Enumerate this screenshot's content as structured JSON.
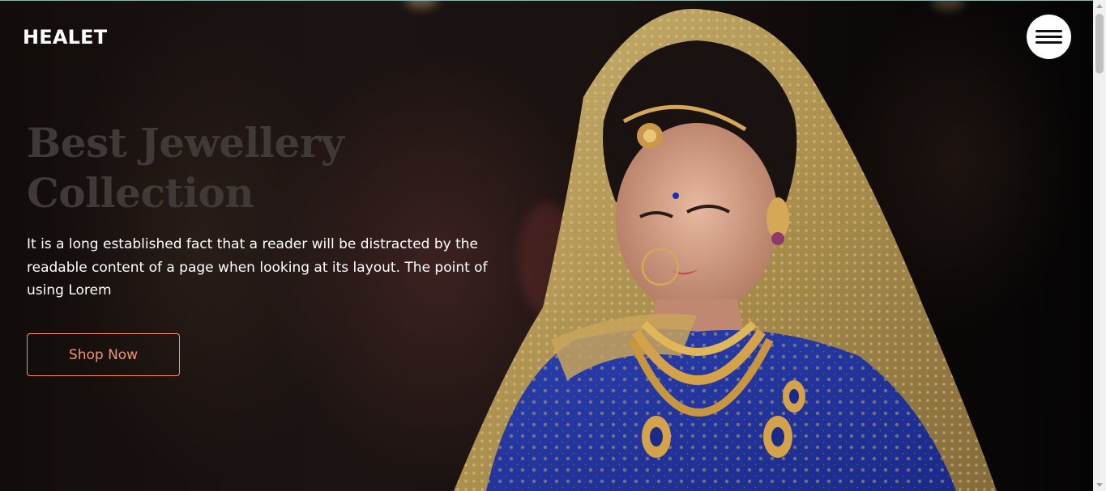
{
  "brand": {
    "logo": "HEALET"
  },
  "hero": {
    "headline_line1": "Best Jewellery",
    "headline_line2": "Collection",
    "description": "It is a long established fact that a reader will be distracted by the readable content of a page when looking at its layout. The point of using Lorem",
    "cta_label": "Shop Now",
    "image_subject": "bride in blue and gold bridal attire with gold jewellery"
  },
  "nav": {
    "menu_icon": "hamburger-menu-icon"
  },
  "colors": {
    "accent": "#f6936a",
    "headline": "#3f3937",
    "background": "#120c0a",
    "text": "#ffffff"
  }
}
